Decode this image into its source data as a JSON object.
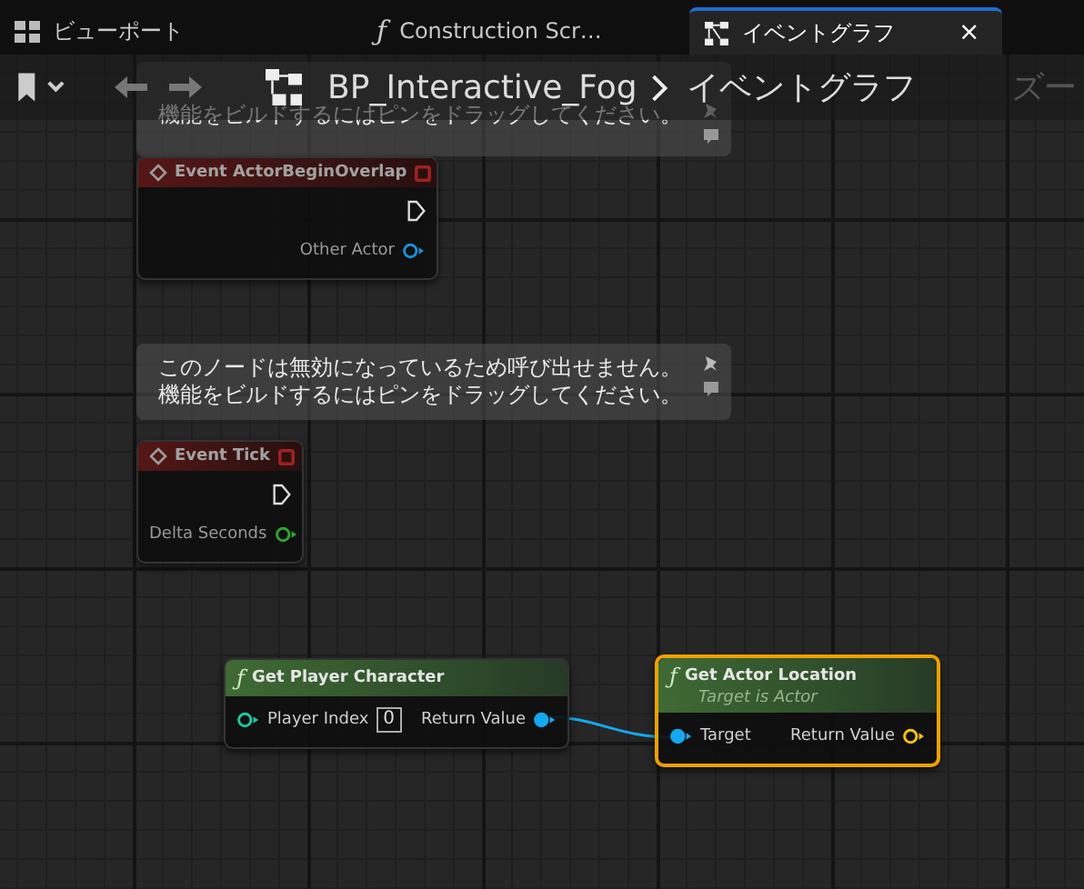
{
  "tabs": [
    {
      "kind": "viewport",
      "label": "ビューポート",
      "selected": false
    },
    {
      "kind": "function",
      "glyph": "ƒ",
      "label": "Construction Scr…",
      "selected": false
    },
    {
      "kind": "graph",
      "label": "イベントグラフ",
      "selected": true,
      "close": "×"
    }
  ],
  "toolbar": {
    "breadcrumb": [
      "BP_Interactive_Fog",
      "イベントグラフ"
    ],
    "zoom_label": "ズー"
  },
  "comments": [
    {
      "lines": [
        "機能をビルドするにはピンをドラッグしてください。"
      ]
    },
    {
      "lines": [
        "このノードは無効になっているため呼び出せません。",
        "機能をビルドするにはピンをドラッグしてください。"
      ]
    }
  ],
  "nodes": [
    {
      "kind": "event",
      "title": "Event ActorBeginOverlap",
      "disabled": true,
      "selected": false,
      "outputs": [
        {
          "kind": "exec",
          "connected": false
        },
        {
          "kind": "data",
          "label": "Other Actor",
          "color": "#1a8fd8",
          "connected": false
        }
      ]
    },
    {
      "kind": "event",
      "title": "Event Tick",
      "disabled": true,
      "selected": false,
      "outputs": [
        {
          "kind": "exec",
          "connected": false
        },
        {
          "kind": "data",
          "label": "Delta Seconds",
          "color": "#2fa52f",
          "connected": false
        }
      ]
    },
    {
      "kind": "function",
      "glyph": "ƒ",
      "title": "Get Player Character",
      "disabled": false,
      "selected": false,
      "inputs": [
        {
          "kind": "data",
          "label": "Player Index",
          "color": "#1fc7a0",
          "connected": false,
          "value": "0"
        }
      ],
      "outputs": [
        {
          "kind": "data",
          "label": "Return Value",
          "color": "#14a8f0",
          "connected": true
        }
      ]
    },
    {
      "kind": "function",
      "glyph": "ƒ",
      "title": "Get Actor Location",
      "subtitle": "Target is Actor",
      "disabled": false,
      "selected": true,
      "inputs": [
        {
          "kind": "data",
          "label": "Target",
          "color": "#14a8f0",
          "connected": true
        }
      ],
      "outputs": [
        {
          "kind": "data",
          "label": "Return Value",
          "color": "#f4c20d",
          "connected": false
        }
      ]
    }
  ]
}
